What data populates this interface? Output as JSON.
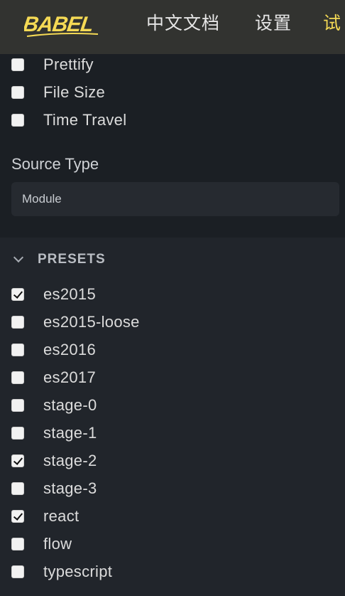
{
  "nav": {
    "logo_text": "BABEL",
    "links": [
      "中文文档",
      "设置",
      "试"
    ]
  },
  "options": [
    {
      "label": "Prettify",
      "checked": false
    },
    {
      "label": "File Size",
      "checked": false
    },
    {
      "label": "Time Travel",
      "checked": false
    }
  ],
  "source_type": {
    "title": "Source Type",
    "value": "Module"
  },
  "presets": {
    "title": "PRESETS",
    "items": [
      {
        "label": "es2015",
        "checked": true
      },
      {
        "label": "es2015-loose",
        "checked": false
      },
      {
        "label": "es2016",
        "checked": false
      },
      {
        "label": "es2017",
        "checked": false
      },
      {
        "label": "stage-0",
        "checked": false
      },
      {
        "label": "stage-1",
        "checked": false
      },
      {
        "label": "stage-2",
        "checked": true
      },
      {
        "label": "stage-3",
        "checked": false
      },
      {
        "label": "react",
        "checked": true
      },
      {
        "label": "flow",
        "checked": false
      },
      {
        "label": "typescript",
        "checked": false
      }
    ]
  },
  "colors": {
    "nav_bg": "#323330",
    "accent": "#f5da55",
    "page_bg": "#21252b"
  }
}
